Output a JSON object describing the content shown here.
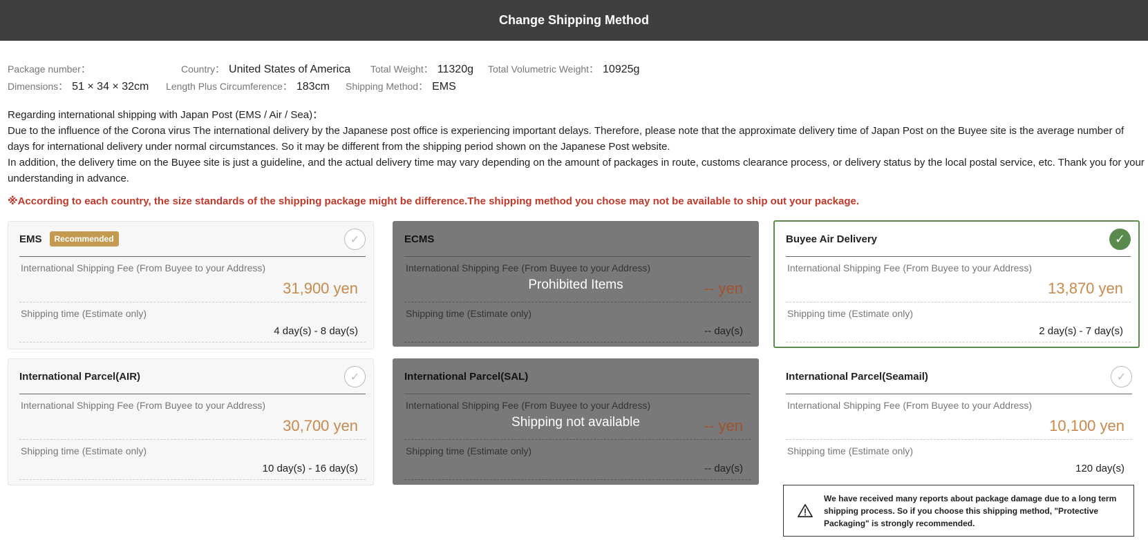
{
  "header": {
    "title": "Change Shipping Method"
  },
  "package": {
    "package_number_label": "Package number：",
    "package_number": "",
    "country_label": "Country：",
    "country": "United States of America",
    "total_weight_label": "Total Weight：",
    "total_weight": "11320g",
    "total_vol_weight_label": "Total Volumetric Weight：",
    "total_vol_weight": "10925g",
    "dimensions_label": "Dimensions：",
    "dimensions": "51 × 34 × 32cm",
    "length_circ_label": "Length Plus Circumference：",
    "length_circ": "183cm",
    "shipping_method_label": "Shipping Method：",
    "shipping_method": "EMS"
  },
  "notice": {
    "heading": "Regarding international shipping with Japan Post (EMS / Air / Sea)：",
    "para1": "Due to the influence of the Corona virus The international delivery by the Japanese post office is experiencing important delays. Therefore, please note that the approximate delivery time of Japan Post on the Buyee site is the average number of days for international delivery under normal circumstances. So it may be different from the shipping period shown on the Japanese Post website.",
    "para2": "In addition, the delivery time on the Buyee site is just a guideline, and the actual delivery time may vary depending on the amount of packages in route, customs clearance process, or delivery status by the local postal service, etc. Thank you for your understanding in advance.",
    "warning": "※According to each country, the size standards of the shipping package might be difference.The shipping method you chose may not be available to ship out your package."
  },
  "labels": {
    "fee": "International Shipping Fee (From Buyee to your Address)",
    "time": "Shipping time (Estimate only)"
  },
  "methods": [
    {
      "name": "EMS",
      "badge": "Recommended",
      "fee": "31,900 yen",
      "time": "4 day(s) - 8 day(s)",
      "state": "available"
    },
    {
      "name": "ECMS",
      "fee": "-- yen",
      "time": "-- day(s)",
      "state": "disabled",
      "overlay": "Prohibited Items"
    },
    {
      "name": "Buyee Air Delivery",
      "fee": "13,870 yen",
      "time": "2 day(s) - 7 day(s)",
      "state": "selected"
    },
    {
      "name": "International Parcel(AIR)",
      "fee": "30,700 yen",
      "time": "10 day(s) - 16 day(s)",
      "state": "available"
    },
    {
      "name": "International Parcel(SAL)",
      "fee": "-- yen",
      "time": "-- day(s)",
      "state": "disabled",
      "overlay": "Shipping not available"
    },
    {
      "name": "International Parcel(Seamail)",
      "fee": "10,100 yen",
      "time": "120 day(s)",
      "state": "available"
    }
  ],
  "seamail_alert": "We have received many reports about package damage due to a long term shipping process. So if you choose this shipping method, \"Protective Packaging\" is strongly recommended.",
  "icons": {
    "check": "check-icon",
    "warning": "warning-triangle-icon"
  },
  "colors": {
    "header_bg": "#3f3f3f",
    "accent_fee": "#c8894d",
    "selected": "#5b8a4f",
    "badge": "#c49a50",
    "warning": "#c0392b"
  }
}
